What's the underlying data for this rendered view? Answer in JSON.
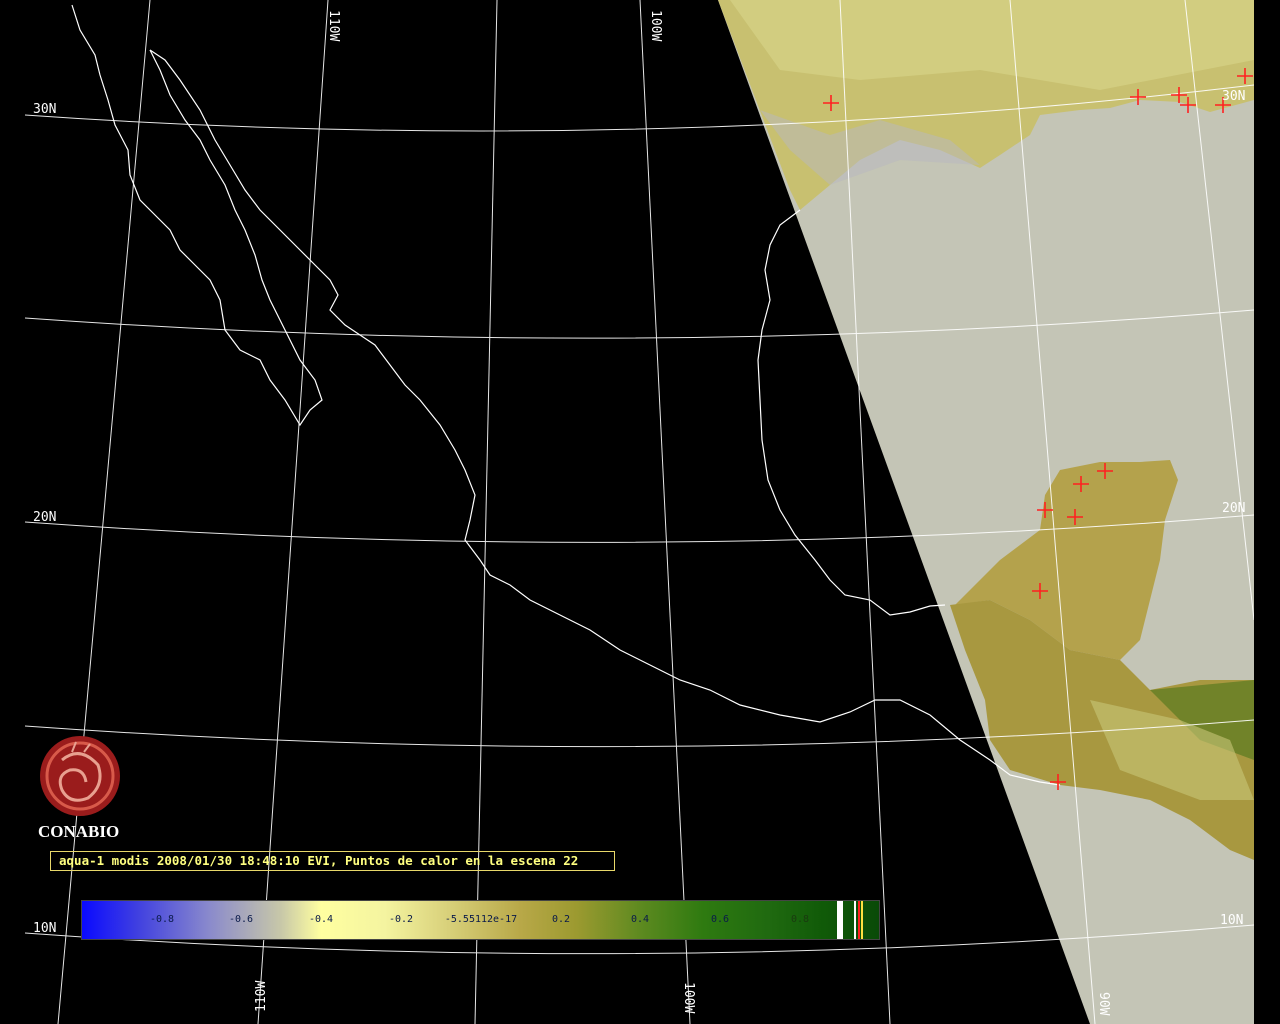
{
  "map": {
    "lat_labels": [
      "30N",
      "20N",
      "10N",
      "30N",
      "20N",
      "10N"
    ],
    "lon_labels": [
      "110W",
      "100W",
      "110W",
      "100W",
      "90W"
    ]
  },
  "logo": {
    "name": "CONABIO",
    "emblem": "conabio-logo-icon"
  },
  "caption": "aqua-1 modis 2008/01/30 18:48:10 EVI, Puntos de calor en la escena 22",
  "colorbar": {
    "ticks": [
      "-0.8",
      "-0.6",
      "-0.4",
      "-0.2",
      "-5.55112e-17",
      "0.2",
      "0.4",
      "0.6",
      "0.8"
    ],
    "colors": {
      "low": "#0a0aff",
      "mid": "#ffffa0",
      "high": "#0a4a08",
      "fire": "#ff2020"
    }
  }
}
